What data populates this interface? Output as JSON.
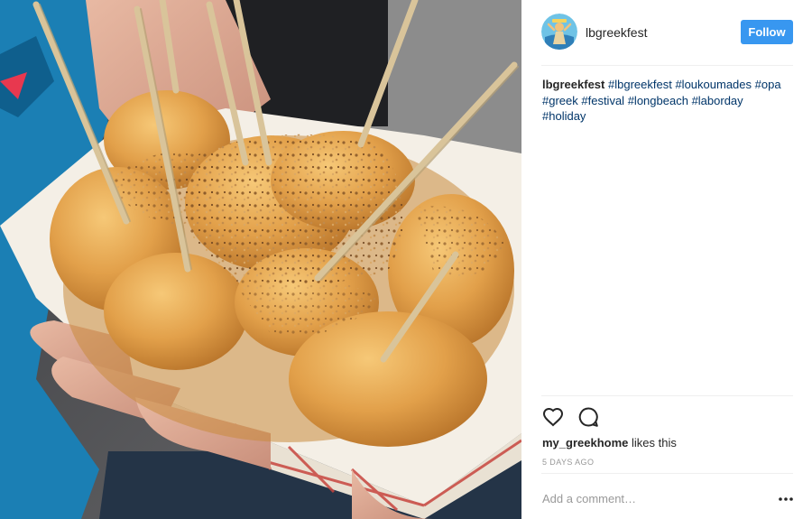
{
  "photo": {
    "description_icon": "loukoumades-photo"
  },
  "header": {
    "username": "lbgreekfest",
    "follow_label": "Follow",
    "avatar_icon": "greek-fest-logo-icon"
  },
  "caption": {
    "username": "lbgreekfest",
    "hashtags": [
      "#lbgreekfest",
      "#loukoumades",
      "#opa",
      "#greek",
      "#festival",
      "#longbeach",
      "#laborday",
      "#holiday"
    ]
  },
  "actions": {
    "like_icon": "heart-icon",
    "comment_icon": "comment-icon"
  },
  "likes": {
    "liker": "my_greekhome",
    "suffix": " likes this"
  },
  "timestamp": "5 DAYS AGO",
  "comment_box": {
    "placeholder": "Add a comment…",
    "more_icon": "more-options-icon"
  },
  "colors": {
    "follow_button": "#3897f0",
    "hashtag": "#003569",
    "divider": "#efefef"
  }
}
